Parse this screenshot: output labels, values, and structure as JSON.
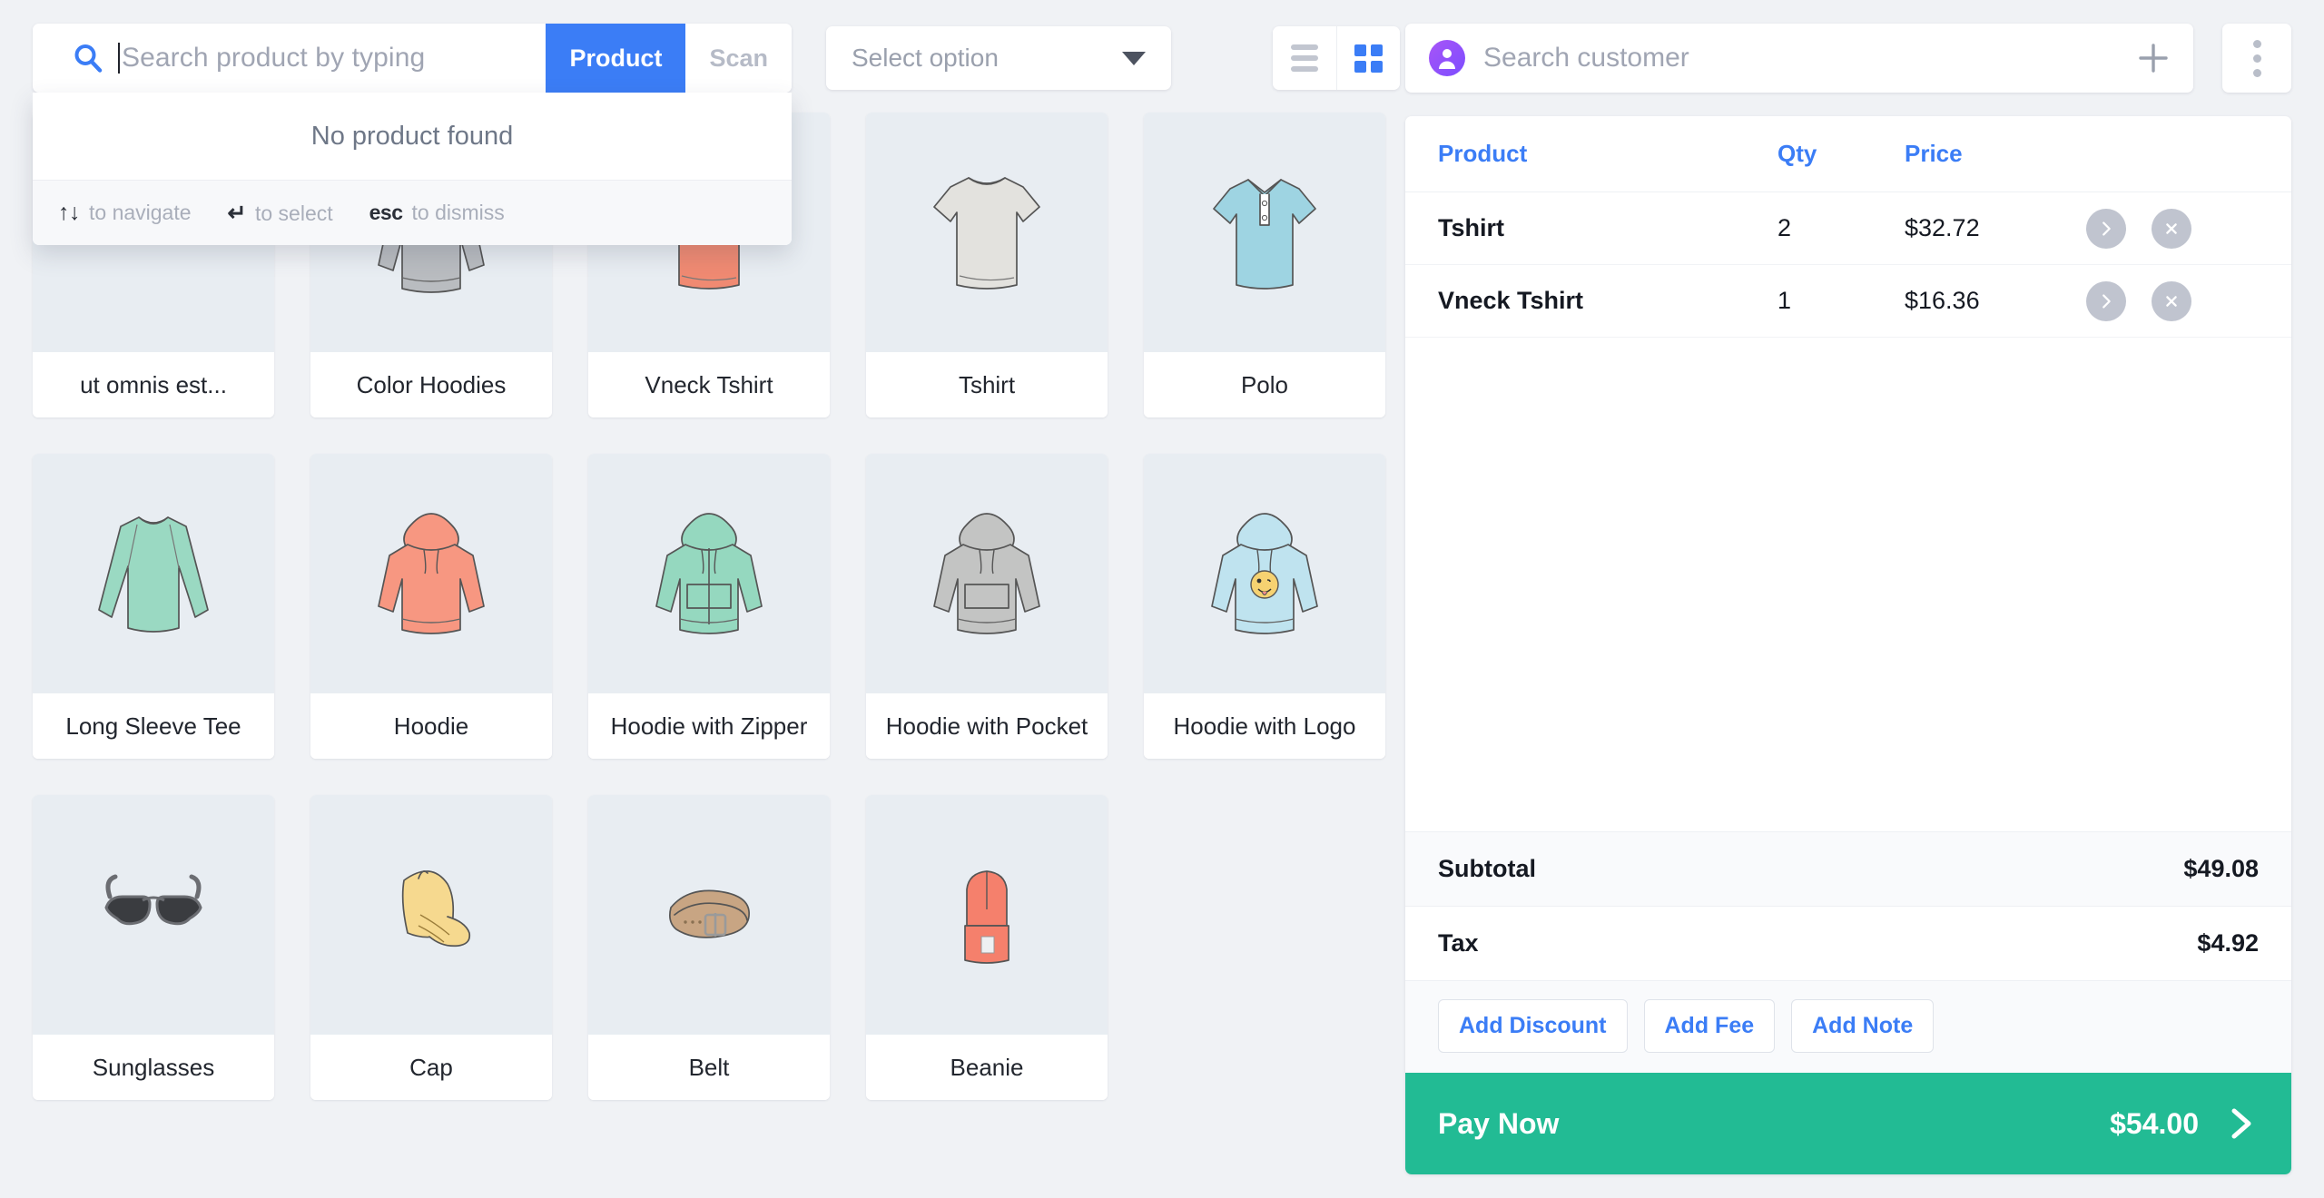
{
  "search": {
    "placeholder": "Search product by typing",
    "icon": "search-icon",
    "value": "",
    "mode_product": "Product",
    "mode_scan": "Scan"
  },
  "dropdown": {
    "empty_text": "No product found",
    "hints": [
      {
        "key": "↑↓",
        "label": "to navigate"
      },
      {
        "key": "↵",
        "label": "to select"
      },
      {
        "key": "esc",
        "label": "to dismiss"
      }
    ]
  },
  "filter": {
    "placeholder": "Select option",
    "icon": "chevron-down-icon"
  },
  "view": {
    "list_icon": "list-view-icon",
    "grid_icon": "grid-view-icon",
    "active": "grid"
  },
  "customer": {
    "placeholder": "Search customer",
    "avatar_icon": "customer-avatar-icon",
    "add_icon": "plus-icon"
  },
  "menu": {
    "icon": "kebab-menu-icon"
  },
  "products": [
    {
      "name": "ut omnis est...",
      "art": "collage",
      "color": "#f2917d"
    },
    {
      "name": "Color Hoodies",
      "art": "hoodie-grey",
      "color": "#b9bcc0"
    },
    {
      "name": "Vneck Tshirt",
      "art": "vneck",
      "color": "#f08a72"
    },
    {
      "name": "Tshirt",
      "art": "tshirt",
      "color": "#e3e2de"
    },
    {
      "name": "Polo",
      "art": "polo",
      "color": "#9ed4e2"
    },
    {
      "name": "Long Sleeve Tee",
      "art": "longsleeve",
      "color": "#9ad9c2"
    },
    {
      "name": "Hoodie",
      "art": "hoodie",
      "color": "#f79781"
    },
    {
      "name": "Hoodie with Zipper",
      "art": "hoodie-zip",
      "color": "#95d8bf"
    },
    {
      "name": "Hoodie with Pocket",
      "art": "hoodie-pocket",
      "color": "#c3c4c3"
    },
    {
      "name": "Hoodie with Logo",
      "art": "hoodie-logo",
      "color": "#bfe3ef"
    },
    {
      "name": "Sunglasses",
      "art": "sunglasses",
      "color": "#8c8e92"
    },
    {
      "name": "Cap",
      "art": "cap",
      "color": "#f6d98f"
    },
    {
      "name": "Belt",
      "art": "belt",
      "color": "#c8a583"
    },
    {
      "name": "Beanie",
      "art": "beanie",
      "color": "#f5806c"
    }
  ],
  "cart": {
    "headers": {
      "product": "Product",
      "qty": "Qty",
      "price": "Price"
    },
    "rows": [
      {
        "product": "Tshirt",
        "qty": "2",
        "price": "$32.72",
        "expand_icon": "chevron-right-icon",
        "remove_icon": "close-icon"
      },
      {
        "product": "Vneck Tshirt",
        "qty": "1",
        "price": "$16.36",
        "expand_icon": "chevron-right-icon",
        "remove_icon": "close-icon"
      }
    ]
  },
  "totals": {
    "subtotal_label": "Subtotal",
    "subtotal_value": "$49.08",
    "tax_label": "Tax",
    "tax_value": "$4.92"
  },
  "actions": {
    "add_discount": "Add Discount",
    "add_fee": "Add Fee",
    "add_note": "Add Note"
  },
  "pay": {
    "label": "Pay Now",
    "amount": "$54.00",
    "icon": "chevron-right-icon"
  },
  "colors": {
    "accent_blue": "#3b7df6",
    "pay_green": "#22bb94",
    "page_bg": "#f0f2f5",
    "thumb_bg": "#e8edf2",
    "muted": "#a0a5b3"
  }
}
